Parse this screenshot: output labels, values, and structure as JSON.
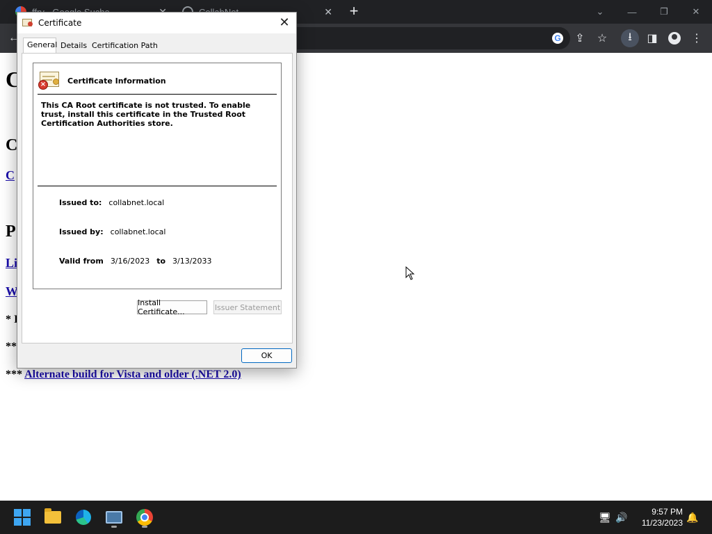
{
  "browser": {
    "tabs": [
      {
        "title": "ffry - Google Suche",
        "close": "✕"
      },
      {
        "title": "CollabNet",
        "close": "✕"
      }
    ],
    "new_tab": "+",
    "window_controls": {
      "tab_search": "⌄",
      "minimize": "—",
      "restore": "❐",
      "close": "✕"
    },
    "toolbar": {
      "back": "←",
      "google": "G",
      "share": "⇪",
      "star": "☆",
      "download": "⭳",
      "sidepanel": "◨",
      "menu": "⋮"
    }
  },
  "page": {
    "heading": "C",
    "section1": "C",
    "link1": "C",
    "section2": "P",
    "link2": "Li",
    "link3": "W",
    "note1": "* I",
    "note2": "**",
    "alt_prefix": "***",
    "alt_link": "Alternate build for Vista and older (.NET 2.0)"
  },
  "dialog": {
    "title": "Certificate",
    "close": "✕",
    "tabs": [
      "General",
      "Details",
      "Certification Path"
    ],
    "info_title": "Certificate Information",
    "warning": "This CA Root certificate is not trusted. To enable trust, install this certificate in the Trusted Root Certification Authorities store.",
    "issued_to_label": "Issued to:",
    "issued_to": "collabnet.local",
    "issued_by_label": "Issued by:",
    "issued_by": "collabnet.local",
    "valid_from_label": "Valid from",
    "valid_from": "3/16/2023",
    "valid_to_label": "to",
    "valid_to": "3/13/2033",
    "install_button": "Install Certificate...",
    "issuer_button": "Issuer Statement",
    "ok_button": "OK"
  },
  "taskbar": {
    "time": "9:57 PM",
    "date": "11/23/2023",
    "tray": {
      "network": "🖥",
      "volume": "🔊",
      "notifications": "🔔"
    }
  },
  "colors": {
    "link": "#1a0dab",
    "chrome_dark": "#202124",
    "toolbar": "#35363a",
    "ok_border": "#0067c0"
  }
}
